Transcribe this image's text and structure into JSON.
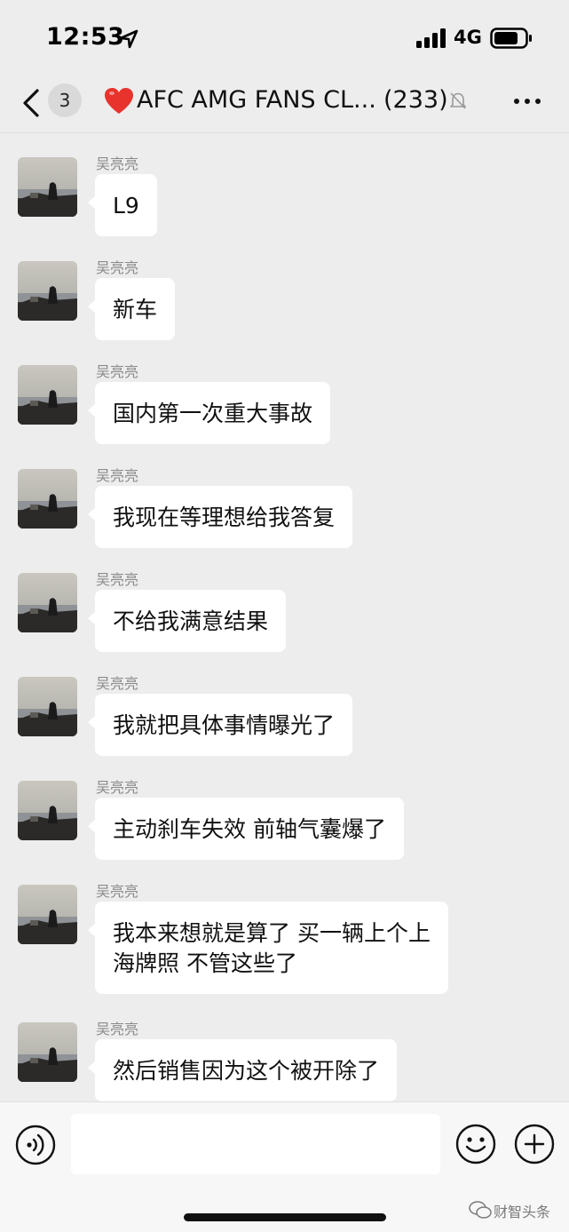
{
  "status_bar": {
    "time": "12:53",
    "network": "4G"
  },
  "nav": {
    "unread_count": "3",
    "title": "AFC AMG FANS CL...",
    "member_count": "(233)"
  },
  "messages": [
    {
      "sender": "吴亮亮",
      "lines": [
        "L9"
      ]
    },
    {
      "sender": "吴亮亮",
      "lines": [
        "新车"
      ]
    },
    {
      "sender": "吴亮亮",
      "lines": [
        "国内第一次重大事故"
      ]
    },
    {
      "sender": "吴亮亮",
      "lines": [
        "我现在等理想给我答复"
      ]
    },
    {
      "sender": "吴亮亮",
      "lines": [
        "不给我满意结果"
      ]
    },
    {
      "sender": "吴亮亮",
      "lines": [
        "我就把具体事情曝光了"
      ]
    },
    {
      "sender": "吴亮亮",
      "lines": [
        "主动刹车失效 前轴气囊爆了"
      ]
    },
    {
      "sender": "吴亮亮",
      "lines": [
        "我本来想就是算了 买一辆上个上",
        "海牌照 不管这些了"
      ]
    },
    {
      "sender": "吴亮亮",
      "lines": [
        "然后销售因为这个被开除了"
      ]
    }
  ],
  "input": {
    "placeholder": ""
  },
  "watermark": {
    "text": "财智头条"
  },
  "colors": {
    "background": "#ededed",
    "bubble": "#ffffff",
    "heart": "#e8332c"
  }
}
